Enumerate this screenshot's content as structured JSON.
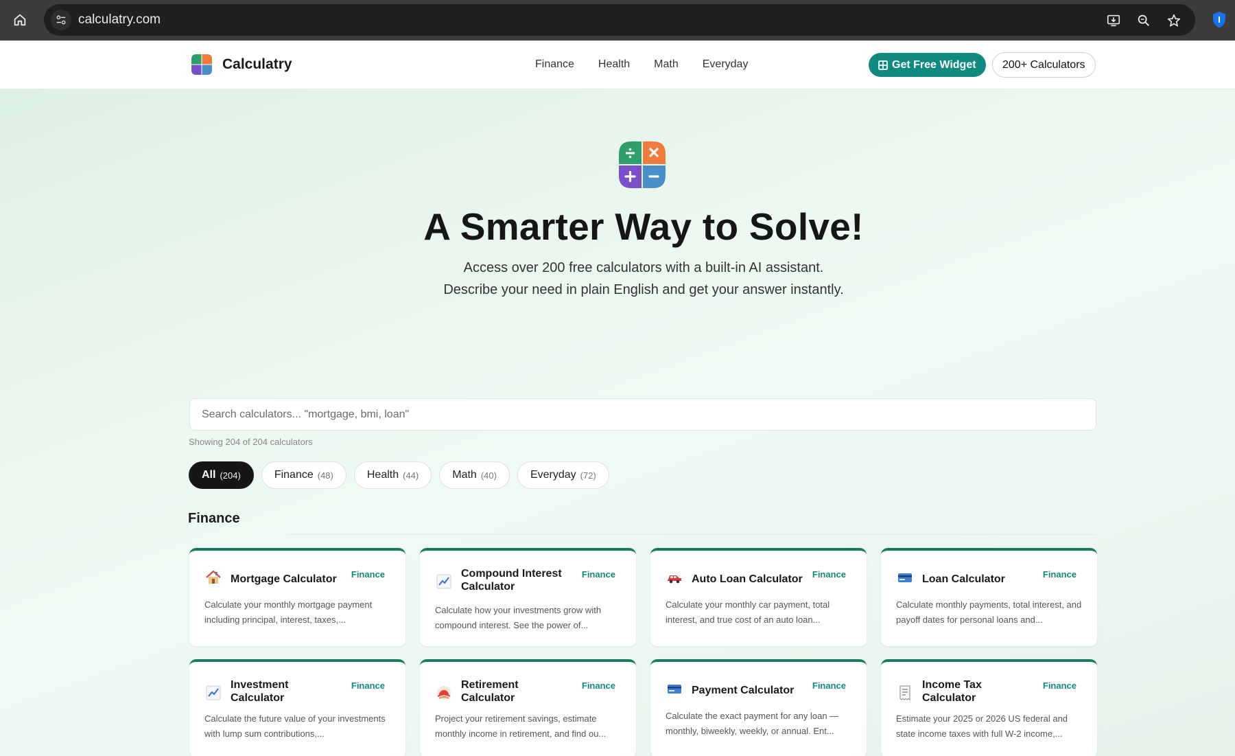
{
  "browser": {
    "url": "calculatry.com"
  },
  "header": {
    "brand": "Calculatry",
    "nav": [
      "Finance",
      "Health",
      "Math",
      "Everyday"
    ],
    "widget_button": "Get Free Widget",
    "calculators_button": "200+ Calculators"
  },
  "hero": {
    "title": "A Smarter Way to Solve!",
    "subtitle_line1": "Access over 200 free calculators with a built-in AI assistant.",
    "subtitle_line2": "Describe your need in plain English and get your answer instantly."
  },
  "search": {
    "placeholder": "Search calculators... \"mortgage, bmi, loan\"",
    "showing": "Showing 204 of 204 calculators"
  },
  "filters": [
    {
      "label": "All",
      "count": "(204)",
      "active": true
    },
    {
      "label": "Finance",
      "count": "(48)",
      "active": false
    },
    {
      "label": "Health",
      "count": "(44)",
      "active": false
    },
    {
      "label": "Math",
      "count": "(40)",
      "active": false
    },
    {
      "label": "Everyday",
      "count": "(72)",
      "active": false
    }
  ],
  "section": {
    "title": "Finance"
  },
  "cards": [
    {
      "name": "Mortgage Calculator",
      "tag": "Finance",
      "icon": "house-icon",
      "desc": "Calculate your monthly mortgage payment including principal, interest, taxes,..."
    },
    {
      "name": "Compound Interest Calculator",
      "tag": "Finance",
      "icon": "chart-increasing-icon",
      "desc": "Calculate how your investments grow with compound interest. See the power of..."
    },
    {
      "name": "Auto Loan Calculator",
      "tag": "Finance",
      "icon": "car-icon",
      "desc": "Calculate your monthly car payment, total interest, and true cost of an auto loan..."
    },
    {
      "name": "Loan Calculator",
      "tag": "Finance",
      "icon": "credit-card-icon",
      "desc": "Calculate monthly payments, total interest, and payoff dates for personal loans and..."
    },
    {
      "name": "Investment Calculator",
      "tag": "Finance",
      "icon": "chart-increasing-icon",
      "desc": "Calculate the future value of your investments with lump sum contributions,..."
    },
    {
      "name": "Retirement Calculator",
      "tag": "Finance",
      "icon": "sunset-icon",
      "desc": "Project your retirement savings, estimate monthly income in retirement, and find ou..."
    },
    {
      "name": "Payment Calculator",
      "tag": "Finance",
      "icon": "credit-card-icon",
      "desc": "Calculate the exact payment for any loan — monthly, biweekly, weekly, or annual. Ent..."
    },
    {
      "name": "Income Tax Calculator",
      "tag": "Finance",
      "icon": "receipt-icon",
      "desc": "Estimate your 2025 or 2026 US federal and state income taxes with full W-2 income,..."
    }
  ],
  "colors": {
    "accent": "#0f8a80",
    "card_border": "#187a5e",
    "logo_green": "#2e9e6b",
    "logo_orange": "#f07b3a",
    "logo_purple": "#7b4fc9",
    "logo_blue": "#4a90c8"
  }
}
